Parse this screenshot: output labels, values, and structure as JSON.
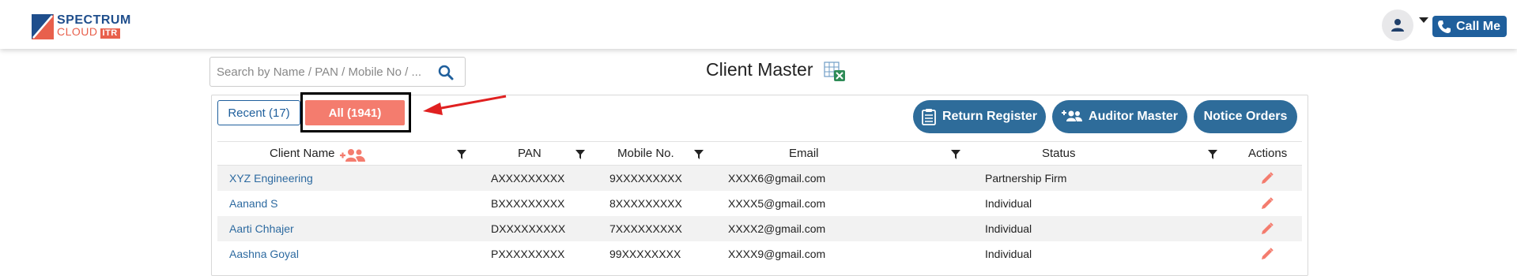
{
  "header": {
    "logo_line1": "SPECTRUM",
    "logo_line2": "CLOUD",
    "logo_badge": "ITR",
    "call_label": "Call Me"
  },
  "search": {
    "placeholder": "Search by Name / PAN / Mobile No / ..."
  },
  "page_title": "Client Master",
  "tabs": {
    "recent_label": "Recent (17)",
    "all_label": "All (1941)"
  },
  "actions": {
    "return_register": "Return Register",
    "auditor_master": "Auditor Master",
    "notice_orders": "Notice Orders"
  },
  "table": {
    "headers": {
      "name": "Client Name",
      "pan": "PAN",
      "mobile": "Mobile No.",
      "email": "Email",
      "status": "Status",
      "actions": "Actions"
    },
    "rows": [
      {
        "name": "XYZ Engineering",
        "pan": "AXXXXXXXXX",
        "mobile": "9XXXXXXXXX",
        "email": "XXXX6@gmail.com",
        "status": "Partnership Firm"
      },
      {
        "name": "Aanand S",
        "pan": "BXXXXXXXXX",
        "mobile": "8XXXXXXXXX",
        "email": "XXXX5@gmail.com",
        "status": "Individual"
      },
      {
        "name": "Aarti Chhajer",
        "pan": "DXXXXXXXXX",
        "mobile": "7XXXXXXXXX",
        "email": "XXXX2@gmail.com",
        "status": "Individual"
      },
      {
        "name": "Aashna Goyal",
        "pan": "PXXXXXXXXX",
        "mobile": "99XXXXXXXX",
        "email": "XXXX9@gmail.com",
        "status": "Individual"
      }
    ]
  },
  "colors": {
    "primary": "#2e6c9a",
    "brand_blue": "#1f4e8c",
    "accent": "#f47c6e",
    "edit_icon": "#f47c6e",
    "arrow": "#e02020"
  }
}
